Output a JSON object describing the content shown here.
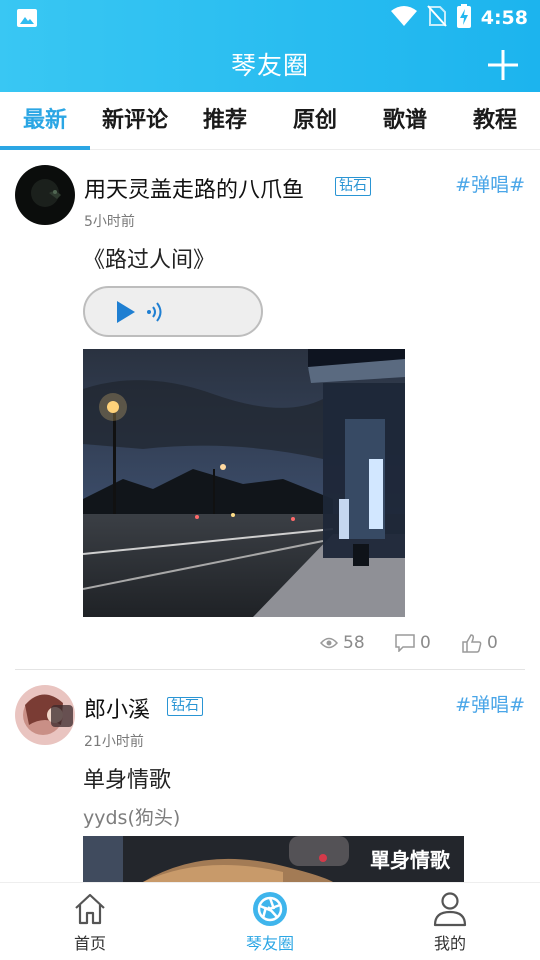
{
  "status_bar": {
    "time": "4:58",
    "icons": [
      "gallery-icon",
      "wifi-icon",
      "no-sim-icon",
      "battery-charging-icon"
    ]
  },
  "header": {
    "title": "琴友圈",
    "add_icon": "plus-icon"
  },
  "tabs": [
    {
      "label": "最新",
      "active": true
    },
    {
      "label": "新评论",
      "active": false
    },
    {
      "label": "推荐",
      "active": false
    },
    {
      "label": "原创",
      "active": false
    },
    {
      "label": "歌谱",
      "active": false
    },
    {
      "label": "教程",
      "active": false
    }
  ],
  "posts": [
    {
      "username": "用天灵盖走路的八爪鱼",
      "badge": "钻石",
      "topic": "#弹唱#",
      "time": "5小时前",
      "text": "《路过人间》",
      "has_audio": true,
      "stats": {
        "views": "58",
        "comments": "0",
        "likes": "0"
      }
    },
    {
      "username": "郎小溪",
      "badge": "钻石",
      "topic": "#弹唱#",
      "time": "21小时前",
      "text": "单身情歌",
      "subtext": "yyds(狗头)",
      "image_caption": "單身情歌"
    }
  ],
  "bottom_nav": [
    {
      "label": "首页",
      "icon": "home-icon",
      "active": false
    },
    {
      "label": "琴友圈",
      "icon": "camera-shutter-icon",
      "active": true
    },
    {
      "label": "我的",
      "icon": "person-icon",
      "active": false
    }
  ],
  "colors": {
    "header_gradient_start": "#39c7f3",
    "header_gradient_end": "#1cb4ee",
    "accent": "#2ba6e4",
    "topic": "#4aa6e8"
  }
}
